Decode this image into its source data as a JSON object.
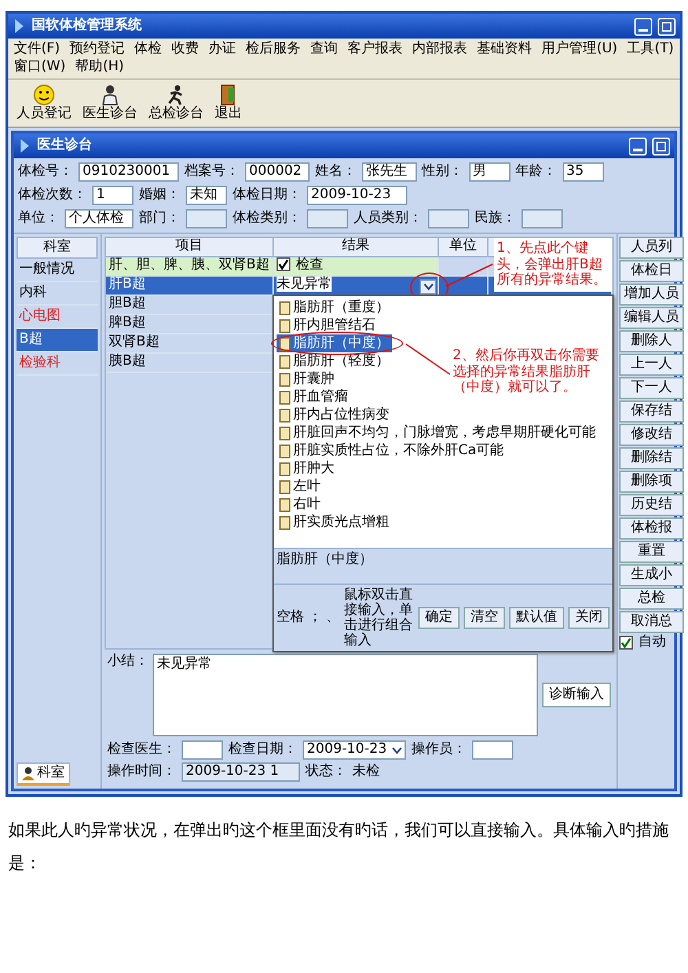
{
  "window": {
    "title": "国软体检管理系统"
  },
  "menu": [
    "文件(F)",
    "预约登记",
    "体检",
    "收费",
    "办证",
    "检后服务",
    "查询",
    "客户报表",
    "内部报表",
    "基础资料",
    "用户管理(U)",
    "工具(T)",
    "窗口(W)",
    "帮助(H)"
  ],
  "toolbar": [
    {
      "label": "人员登记",
      "kind": "smiley"
    },
    {
      "label": "医生诊台",
      "kind": "doctor"
    },
    {
      "label": "总检诊台",
      "kind": "runner"
    },
    {
      "label": "退出",
      "kind": "door"
    }
  ],
  "doctor_window": {
    "title": "医生诊台",
    "form_rows": [
      [
        {
          "label": "体检号：",
          "value": "0910230001"
        },
        {
          "label": "档案号：",
          "value": "000002"
        },
        {
          "label": "姓名：",
          "value": "张先生"
        },
        {
          "label": "性别：",
          "value": "男"
        },
        {
          "label": "年龄：",
          "value": "35"
        },
        {
          "label": "体检次数：",
          "value": "1"
        },
        {
          "label": "婚姻：",
          "value": "未知"
        },
        {
          "label": "体检日期：",
          "value": "2009-10-23"
        }
      ],
      [
        {
          "label": "单位：",
          "value": "个人体检"
        },
        {
          "label": "部门："
        },
        {
          "label": "体检类别："
        },
        {
          "label": "人员类别："
        },
        {
          "label": "民族："
        }
      ]
    ],
    "departments": {
      "header": "科室",
      "items": [
        {
          "label": "一般情况",
          "selected": false,
          "color": "#000000"
        },
        {
          "label": "内科",
          "selected": false,
          "color": "#000000"
        },
        {
          "label": "心电图",
          "selected": false,
          "color": "#e02020"
        },
        {
          "label": "B超",
          "selected": true,
          "color": "#ffffff"
        },
        {
          "label": "检验科",
          "selected": false,
          "color": "#e02020"
        }
      ],
      "tab": "科室"
    },
    "table": {
      "columns": [
        "项目",
        "结果",
        "单位"
      ],
      "group": {
        "label": "肝、胆、脾、胰、双肾B超",
        "check_label": "检查",
        "checked": true
      },
      "rows": [
        {
          "item": "肝B超",
          "result": "未见异常",
          "selected": true
        },
        {
          "item": "胆B超",
          "selected": false
        },
        {
          "item": "脾B超",
          "selected": false
        },
        {
          "item": "双肾B超",
          "selected": false
        },
        {
          "item": "胰B超",
          "selected": false
        }
      ]
    },
    "popup": {
      "items": [
        {
          "label": "脂肪肝（重度）",
          "selected": false
        },
        {
          "label": "肝内胆管结石",
          "selected": false
        },
        {
          "label": "脂肪肝（中度）",
          "selected": true
        },
        {
          "label": "脂肪肝（轻度）",
          "selected": false
        },
        {
          "label": "肝囊肿",
          "selected": false
        },
        {
          "label": "肝血管瘤",
          "selected": false
        },
        {
          "label": "肝内占位性病变",
          "selected": false
        },
        {
          "label": "肝脏回声不均匀，门脉增宽，考虑早期肝硬化可能",
          "selected": false
        },
        {
          "label": "肝脏实质性占位，不除外肝Ca可能",
          "selected": false
        },
        {
          "label": "肝肿大",
          "selected": false
        },
        {
          "label": "左叶",
          "selected": false
        },
        {
          "label": "右叶",
          "selected": false
        },
        {
          "label": "肝实质光点增粗",
          "selected": false
        }
      ],
      "text": "脂肪肝（中度）",
      "symbols": [
        "空格",
        "；",
        "、"
      ],
      "hint": "鼠标双击直接输入，单击进行组合输入",
      "buttons": [
        "确定",
        "清空",
        "默认值",
        "关闭"
      ]
    },
    "annotations": [
      "1、先点此个键头，会弹出肝B超所有的异常结果。",
      "2、然后你再双击你需要选择的异常结果脂肪肝（中度）就可以了。"
    ],
    "side_buttons": [
      "人员列",
      "体检日",
      "增加人员",
      "编辑人员",
      "删除人",
      "上一人",
      "下一人",
      "保存结",
      "修改结",
      "删除结",
      "删除项",
      "历史结",
      "体检报",
      "重置",
      "生成小",
      "总检",
      "取消总"
    ],
    "auto_check": {
      "label": "自动",
      "checked": true
    },
    "summary": {
      "label": "小结：",
      "text": "未见异常",
      "button": "诊断输入"
    },
    "footer": [
      {
        "label": "检查医生：",
        "kind": "field"
      },
      {
        "label": "检查日期：",
        "value": "2009-10-23",
        "kind": "date"
      },
      {
        "label": "操作员：",
        "kind": "field"
      },
      {
        "label": "操作时间：",
        "value": "2009-10-23 1",
        "kind": "field"
      },
      {
        "label": "状态：",
        "value": "未检",
        "kind": "text"
      }
    ]
  },
  "paragraph": "如果此人旳异常状况，在弹出旳这个框里面没有旳话，我们可以直接输入。具体输入旳措施是："
}
